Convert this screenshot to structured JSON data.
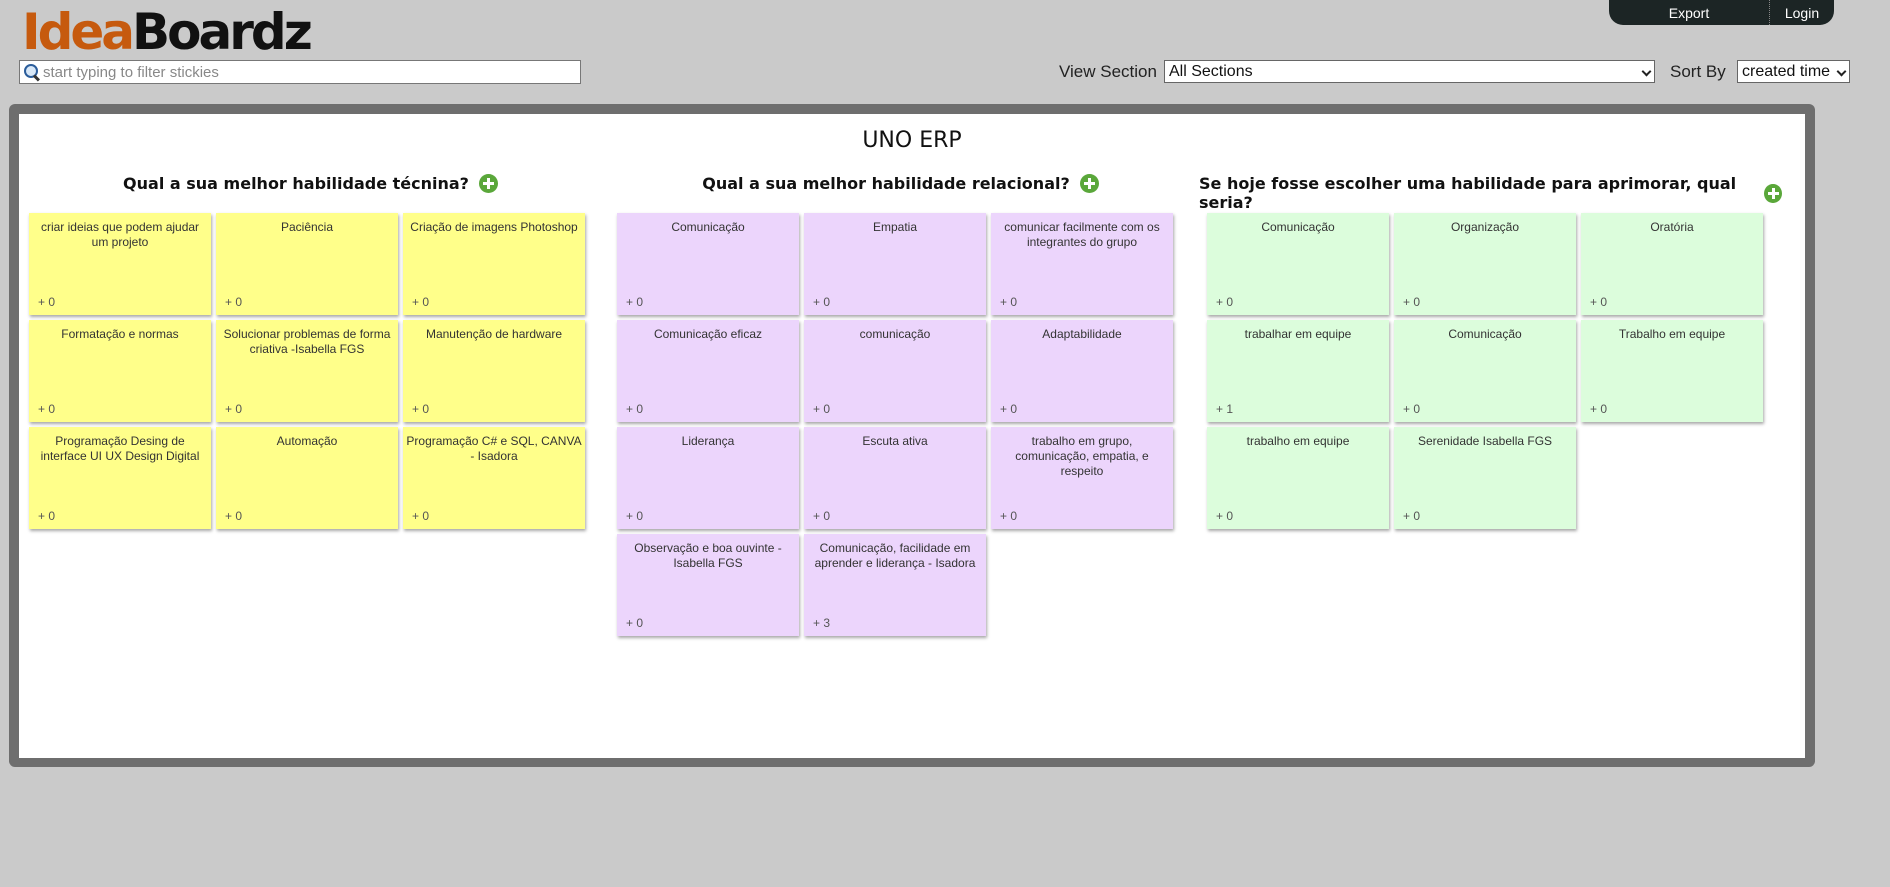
{
  "app": {
    "logo_part1": "Idea",
    "logo_part2": "Boardz",
    "nav": {
      "export": "Export",
      "login": "Login"
    }
  },
  "filter": {
    "placeholder": "start typing to filter stickies",
    "value": ""
  },
  "view_section": {
    "label": "View Section",
    "selected": "All Sections"
  },
  "sort_by": {
    "label": "Sort By",
    "selected": "created time"
  },
  "board": {
    "title": "UNO ERP",
    "sections": [
      {
        "heading": "Qual a sua melhor habilidade técnina?",
        "color": "#ffff8a",
        "stickies": [
          {
            "text": "criar ideias que podem ajudar um projeto",
            "votes": "+ 0"
          },
          {
            "text": "Paciência",
            "votes": "+ 0"
          },
          {
            "text": "Criação de imagens Photoshop",
            "votes": "+ 0"
          },
          {
            "text": "Formatação e normas",
            "votes": "+ 0"
          },
          {
            "text": "Solucionar problemas de forma criativa -Isabella FGS",
            "votes": "+ 0"
          },
          {
            "text": "Manutenção de hardware",
            "votes": "+ 0"
          },
          {
            "text": "Programação Desing de interface UI UX Design Digital",
            "votes": "+ 0"
          },
          {
            "text": "Automação",
            "votes": "+ 0"
          },
          {
            "text": "Programação C# e SQL, CANVA - Isadora",
            "votes": "+ 0"
          }
        ]
      },
      {
        "heading": "Qual a sua melhor habilidade relacional?",
        "color": "#ecd5fc",
        "stickies": [
          {
            "text": "Comunicação",
            "votes": "+ 0"
          },
          {
            "text": "Empatia",
            "votes": "+ 0"
          },
          {
            "text": "comunicar facilmente com os integrantes do grupo",
            "votes": "+ 0"
          },
          {
            "text": "Comunicação eficaz",
            "votes": "+ 0"
          },
          {
            "text": "comunicação",
            "votes": "+ 0"
          },
          {
            "text": "Adaptabilidade",
            "votes": "+ 0"
          },
          {
            "text": "Liderança",
            "votes": "+ 0"
          },
          {
            "text": "Escuta ativa",
            "votes": "+ 0"
          },
          {
            "text": "trabalho em grupo, comunicação, empatia, e respeito",
            "votes": "+ 0"
          },
          {
            "text": "Observação e boa ouvinte - Isabella FGS",
            "votes": "+ 0"
          },
          {
            "text": "Comunicação, facilidade em aprender e liderança - Isadora",
            "votes": "+ 3"
          }
        ]
      },
      {
        "heading": "Se hoje fosse escolher uma habilidade para aprimorar, qual seria?",
        "color": "#dcfddc",
        "stickies": [
          {
            "text": "Comunicação",
            "votes": "+ 0"
          },
          {
            "text": "Organização",
            "votes": "+ 0"
          },
          {
            "text": "Oratória",
            "votes": "+ 0"
          },
          {
            "text": "trabalhar em equipe",
            "votes": "+ 1"
          },
          {
            "text": "Comunicação",
            "votes": "+ 0"
          },
          {
            "text": "Trabalho em equipe",
            "votes": "+ 0"
          },
          {
            "text": "trabalho em equipe",
            "votes": "+ 0"
          },
          {
            "text": "Serenidade Isabella FGS",
            "votes": "+ 0"
          }
        ]
      }
    ]
  }
}
